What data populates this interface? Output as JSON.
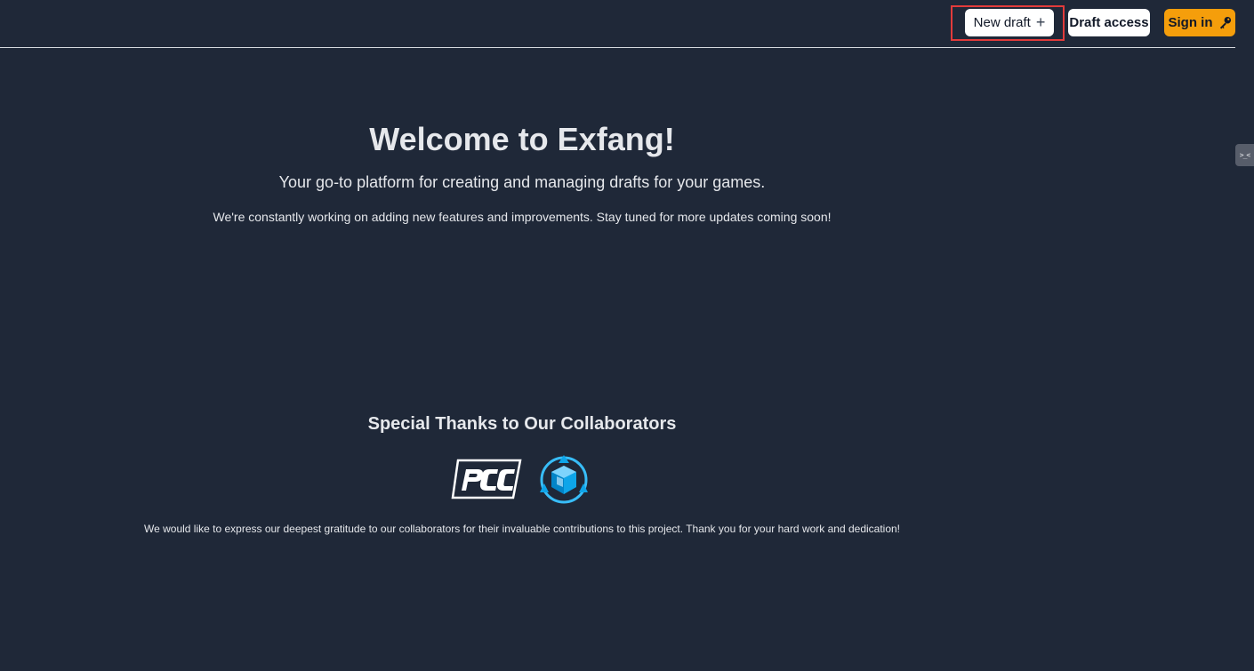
{
  "header": {
    "new_draft_label": "New draft",
    "draft_access_label": "Draft access",
    "sign_in_label": "Sign in",
    "plus_icon": "+",
    "key_icon": "key-icon"
  },
  "side_tab": {
    "glyph": ">_<"
  },
  "hero": {
    "title": "Welcome to Exfang!",
    "subtitle": "Your go-to platform for creating and managing drafts for your games.",
    "note": "We're constantly working on adding new features and improvements. Stay tuned for more updates coming soon!"
  },
  "collaborators": {
    "title": "Special Thanks to Our Collaborators",
    "logos": [
      {
        "name": "pcc-logo",
        "text": "PCC"
      },
      {
        "name": "cube-logo"
      }
    ],
    "note": "We would like to express our deepest gratitude to our collaborators for their invaluable contributions to this project. Thank you for your hard work and dedication!"
  },
  "colors": {
    "background": "#1f2838",
    "sign_in": "#f59e0b",
    "highlight": "#e23b3b",
    "cube_blue": "#38bdf8"
  }
}
